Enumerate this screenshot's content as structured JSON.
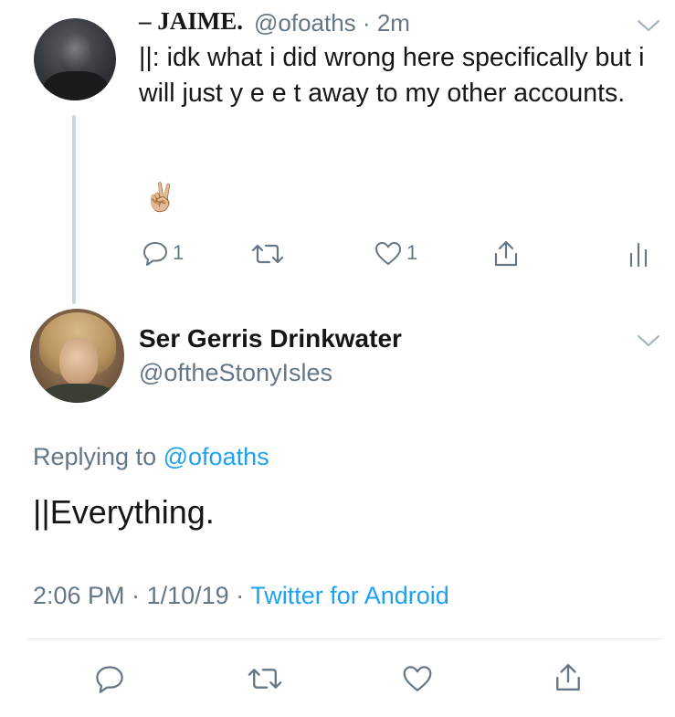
{
  "parent_tweet": {
    "display_name": "– JAIME.",
    "handle": "@ofoaths",
    "separator": "·",
    "age": "2m",
    "text": "||: idk what i did wrong here specifically but i will just y e e t away to my other accounts.",
    "emoji": "✌🏼",
    "reply_count": "1",
    "like_count": "1"
  },
  "main_tweet": {
    "display_name": "Ser Gerris Drinkwater",
    "handle": "@oftheStonyIsles",
    "replying_prefix": "Replying to",
    "replying_to": "@ofoaths",
    "text": "||Everything.",
    "time": "2:06 PM",
    "date": "1/10/19",
    "separator": "·",
    "source": "Twitter for Android"
  },
  "colors": {
    "text": "#14171a",
    "secondary": "#657786",
    "link": "#1da1f2",
    "thread_line": "#ccd6dd",
    "divider": "#e1e8ed"
  },
  "icons": [
    "chevron-down-icon",
    "reply-icon",
    "retweet-icon",
    "heart-icon",
    "share-icon",
    "stats-icon"
  ]
}
